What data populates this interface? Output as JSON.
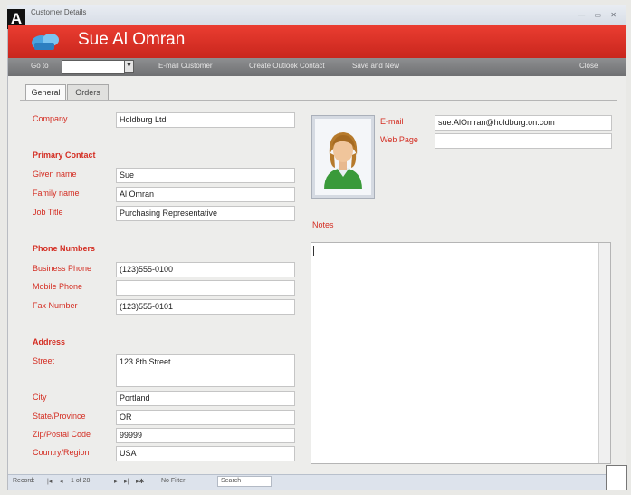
{
  "window": {
    "badge": "A",
    "title": "Customer Details",
    "controls": "— ▭ ✕"
  },
  "header": {
    "title": "Sue Al Omran"
  },
  "toolbar": {
    "goto_label": "Go to",
    "goto_value": "",
    "email_customer": "E-mail Customer",
    "create_outlook": "Create Outlook Contact",
    "save_and_new": "Save and New",
    "close": "Close"
  },
  "tabs": [
    {
      "label": "General"
    },
    {
      "label": "Orders"
    }
  ],
  "form": {
    "company": {
      "label": "Company",
      "value": "Holdburg Ltd"
    },
    "primary_contact_heading": "Primary Contact",
    "given_name": {
      "label": "Given name",
      "value": "Sue"
    },
    "family_name": {
      "label": "Family name",
      "value": "Al Omran"
    },
    "job_title": {
      "label": "Job Title",
      "value": "Purchasing Representative"
    },
    "phone_heading": "Phone Numbers",
    "business_phone": {
      "label": "Business Phone",
      "value": "(123)555-0100"
    },
    "mobile_phone": {
      "label": "Mobile Phone",
      "value": ""
    },
    "fax_number": {
      "label": "Fax Number",
      "value": "(123)555-0101"
    },
    "address_heading": "Address",
    "street": {
      "label": "Street",
      "value": "123 8th Street"
    },
    "city": {
      "label": "City",
      "value": "Portland"
    },
    "state": {
      "label": "State/Province",
      "value": "OR"
    },
    "zip": {
      "label": "Zip/Postal Code",
      "value": "99999"
    },
    "country": {
      "label": "Country/Region",
      "value": "USA"
    },
    "email": {
      "label": "E-mail",
      "value": "sue.AlOmran@holdburg.on.com"
    },
    "web_page": {
      "label": "Web Page",
      "value": ""
    },
    "notes": {
      "label": "Notes",
      "value": ""
    }
  },
  "statusbar": {
    "record_label": "Record:",
    "nav_first": "|◂",
    "nav_prev": "◂",
    "position": "1 of 28",
    "nav_next": "▸",
    "nav_last": "▸|",
    "nav_new": "▸✱",
    "filter": "No Filter",
    "search": "Search"
  },
  "colors": {
    "accent_red": "#d42d22",
    "header_red": "#dc3227",
    "toolbar_gray": "#7d7e80"
  },
  "icons": {
    "header": "contact-card-icon",
    "photo": "person-avatar-icon",
    "dropdown": "chevron-down-icon"
  }
}
